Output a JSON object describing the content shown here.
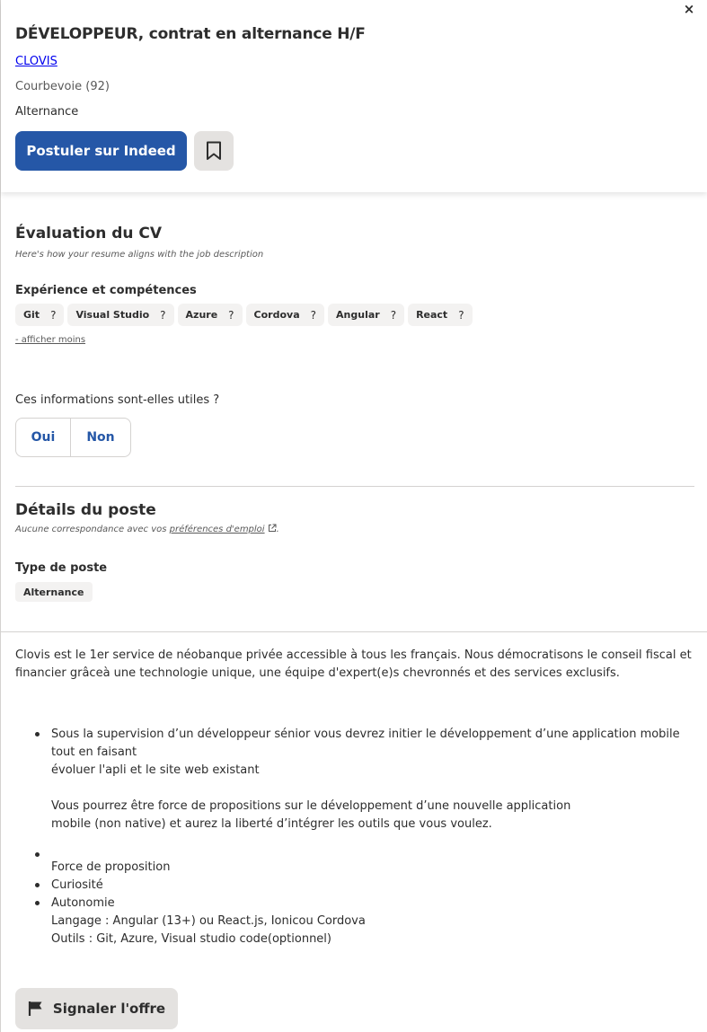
{
  "header": {
    "close_label": "×",
    "job_title": "DÉVELOPPEUR, contrat en alternance H/F",
    "company": "CLOVIS",
    "location": "Courbevoie (92)",
    "contract_type": "Alternance",
    "apply_label": "Postuler sur Indeed"
  },
  "cv_evaluation": {
    "title": "Évaluation du CV",
    "subtitle": "Here's how your resume aligns with the job description",
    "skills_heading": "Expérience et compétences",
    "skills": [
      "Git",
      "Visual Studio",
      "Azure",
      "Cordova",
      "Angular",
      "React"
    ],
    "skill_help_glyph": "?",
    "show_less": "- afficher moins"
  },
  "feedback": {
    "question": "Ces informations sont-elles utiles ?",
    "yes": "Oui",
    "no": "Non"
  },
  "job_details": {
    "title": "Détails du poste",
    "prefs_prefix": "Aucune correspondance avec vos ",
    "prefs_link": "préférences d'emploi",
    "prefs_suffix": ".",
    "type_heading": "Type de poste",
    "type_value": "Alternance"
  },
  "description": {
    "intro": "Clovis est le 1er service de néobanque privée accessible à tous les français. Nous démocratisons le conseil fiscal et financier grâceà une technologie unique, une équipe d'expert(e)s chevronnés et des services exclusifs.",
    "b1_l1": "Sous la supervision d’un développeur sénior vous devrez initier le développement d’une application mobile tout en faisant",
    "b1_l2": "évoluer l'apli et le site web existant",
    "b1_l3": "Vous pourrez être force de propositions sur le développement d’une nouvelle application",
    "b1_l4": "mobile (non native) et aurez la liberté d’intégrer les outils que vous voulez.",
    "b2_l1": "Force de proposition",
    "b3": "Curiosité",
    "b4_l1": "Autonomie",
    "b4_l2": "Langage : Angular (13+) ou React.js, Ionicou Cordova",
    "b4_l3": "Outils : Git, Azure, Visual studio code(optionnel)"
  },
  "report_label": "Signaler l'offre",
  "icons": {
    "save": "bookmark-icon",
    "external": "external-link-icon",
    "report": "flag-icon",
    "close": "close-icon"
  },
  "colors": {
    "accent": "#2557a7",
    "chip_bg": "#f3f2f1",
    "button_grey": "#e4e2e0"
  }
}
